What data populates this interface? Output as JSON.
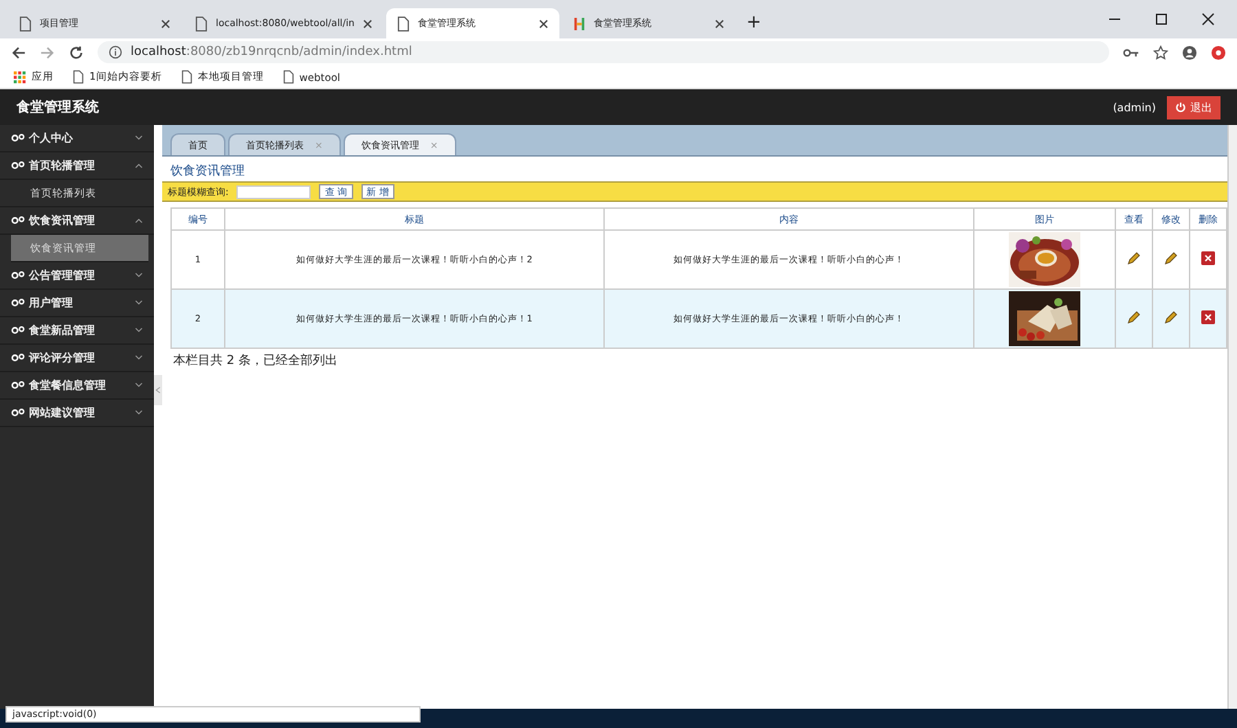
{
  "browser": {
    "tabs": [
      {
        "title": "项目管理",
        "selected": false,
        "kind": "page"
      },
      {
        "title": "localhost:8080/webtool/all/in",
        "selected": false,
        "kind": "page"
      },
      {
        "title": "食堂管理系统",
        "selected": true,
        "kind": "page"
      },
      {
        "title": "食堂管理系统",
        "selected": false,
        "kind": "site"
      }
    ],
    "new_tab": "+",
    "url_host": "localhost",
    "url_rest": ":8080/zb19nrqcnb/admin/index.html",
    "bookmarks": [
      {
        "label": "应用",
        "kind": "apps"
      },
      {
        "label": "1间始内容要析",
        "kind": "page"
      },
      {
        "label": "本地项目管理",
        "kind": "page"
      },
      {
        "label": "webtool",
        "kind": "page"
      }
    ]
  },
  "app": {
    "title": "食堂管理系统",
    "user": "(admin)",
    "logout": "退出"
  },
  "sidebar": [
    {
      "label": "个人中心",
      "expanded": false
    },
    {
      "label": "首页轮播管理",
      "expanded": true,
      "children": [
        {
          "label": "首页轮播列表",
          "selected": false
        }
      ]
    },
    {
      "label": "饮食资讯管理",
      "expanded": true,
      "children": [
        {
          "label": "饮食资讯管理",
          "selected": true
        }
      ]
    },
    {
      "label": "公告管理管理",
      "expanded": false
    },
    {
      "label": "用户管理",
      "expanded": false
    },
    {
      "label": "食堂新品管理",
      "expanded": false
    },
    {
      "label": "评论评分管理",
      "expanded": false
    },
    {
      "label": "食堂餐信息管理",
      "expanded": false
    },
    {
      "label": "网站建议管理",
      "expanded": false
    }
  ],
  "content_tabs": [
    {
      "label": "首页",
      "closable": false,
      "selected": false
    },
    {
      "label": "首页轮播列表",
      "closable": true,
      "selected": false
    },
    {
      "label": "饮食资讯管理",
      "closable": true,
      "selected": true
    }
  ],
  "close_mark": "×",
  "heading": "饮食资讯管理",
  "search": {
    "label": "标题模糊查询:",
    "button": "查 询",
    "add": "新 增"
  },
  "table": {
    "columns": [
      "编号",
      "标题",
      "内容",
      "图片",
      "查看",
      "修改",
      "删除"
    ],
    "rows": [
      {
        "id": "1",
        "title": "如何做好大学生涯的最后一次课程！听听小白的心声！2",
        "content": "如何做好大学生涯的最后一次课程！听听小白的心声！"
      },
      {
        "id": "2",
        "title": "如何做好大学生涯的最后一次课程！听听小白的心声！1",
        "content": "如何做好大学生涯的最后一次课程！听听小白的心声！"
      }
    ]
  },
  "footer": "本栏目共 2 条，已经全部列出",
  "status_bar": "javascript:void(0)"
}
